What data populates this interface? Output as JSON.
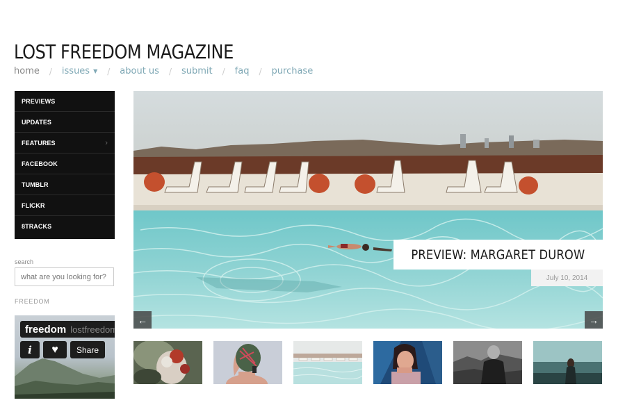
{
  "header": {
    "title": "LOST FREEDOM MAGAZINE",
    "nav": [
      {
        "label": "home"
      },
      {
        "label": "issues",
        "has_dropdown": true
      },
      {
        "label": "about us"
      },
      {
        "label": "submit"
      },
      {
        "label": "faq"
      },
      {
        "label": "purchase"
      }
    ],
    "separator": "/"
  },
  "sidebar": {
    "menu": [
      {
        "label": "PREVIEWS"
      },
      {
        "label": "UPDATES"
      },
      {
        "label": "FEATURES",
        "has_submenu": true
      },
      {
        "label": "FACEBOOK"
      },
      {
        "label": "TUMBLR"
      },
      {
        "label": "FLICKR"
      },
      {
        "label": "8TRACKS"
      }
    ],
    "search": {
      "label": "search",
      "placeholder": "what are you looking for?"
    },
    "freedom_heading": "FREEDOM",
    "widget": {
      "title": "freedom",
      "username": "lostfreedom",
      "share_label": "Share"
    }
  },
  "slider": {
    "caption": "PREVIEW: MARGARET DUROW",
    "date": "July 10, 2014",
    "prev_arrow": "←",
    "next_arrow": "→"
  },
  "thumbnails": [
    {
      "name": "thumb-floral-portrait"
    },
    {
      "name": "thumb-hidden-face"
    },
    {
      "name": "thumb-pool"
    },
    {
      "name": "thumb-blue-portrait"
    },
    {
      "name": "thumb-bw-man"
    },
    {
      "name": "thumb-teal-silhouette"
    }
  ],
  "colors": {
    "accent_link": "#7fa8b5",
    "menu_bg": "#111111",
    "pool_water": "#8fd3d3"
  }
}
